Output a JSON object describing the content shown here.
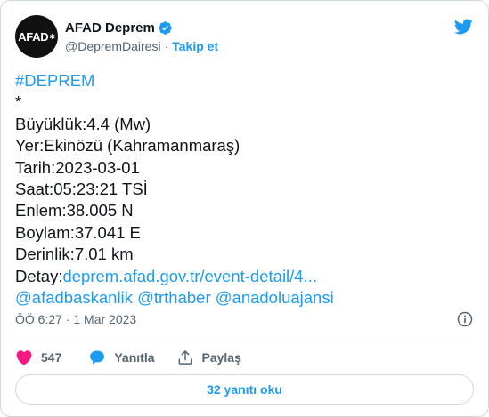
{
  "author": {
    "avatar_text": "AFAD",
    "display_name": "AFAD Deprem",
    "handle": "@DepremDairesi",
    "separator": "·",
    "follow_label": "Takip et"
  },
  "tweet": {
    "hashtag": "#DEPREM",
    "star": "*",
    "lines": [
      "Büyüklük:4.4 (Mw)",
      "Yer:Ekinözü (Kahramanmaraş)",
      "Tarih:2023-03-01",
      "Saat:05:23:21 TSİ",
      "Enlem:38.005 N",
      "Boylam:37.041 E",
      "Derinlik:7.01 km"
    ],
    "detail_label": "Detay:",
    "detail_link": "deprem.afad.gov.tr/event-detail/4...",
    "mentions": [
      "@afadbaskanlik",
      "@trthaber",
      "@anadoluajansi"
    ]
  },
  "meta": {
    "timestamp": "ÖÖ 6:27 · 1 Mar 2023"
  },
  "actions": {
    "like_count": "547",
    "reply_label": "Yanıtla",
    "share_label": "Paylaş"
  },
  "replies_button": "32 yanıtı oku",
  "colors": {
    "accent": "#1d9bf0",
    "like": "#f91880",
    "text": "#0f1419",
    "muted": "#536471"
  }
}
